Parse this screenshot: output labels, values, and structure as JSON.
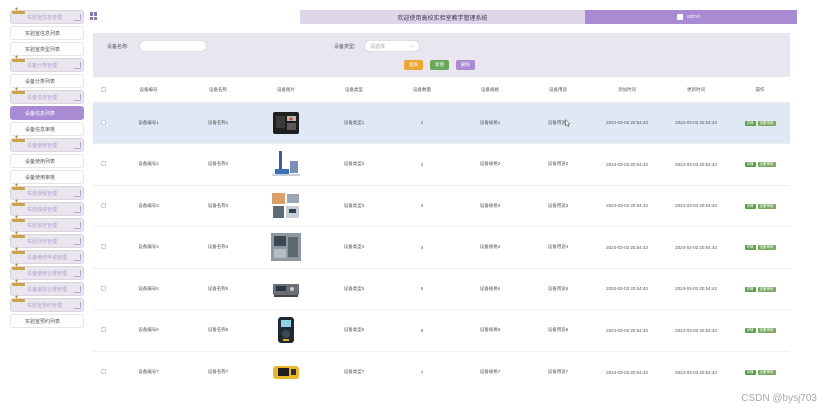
{
  "header": {
    "title": "欢迎使用高校实验室教学管理系统",
    "username": "admin"
  },
  "sidebar": {
    "items": [
      {
        "type": "group",
        "label": "实验室信息管理"
      },
      {
        "type": "sub",
        "label": "实验室信息列表"
      },
      {
        "type": "sub",
        "label": "实验室类型列表"
      },
      {
        "type": "group",
        "label": "设备分类管理"
      },
      {
        "type": "sub",
        "label": "设备分类列表"
      },
      {
        "type": "group",
        "label": "设备信息管理"
      },
      {
        "type": "sub",
        "label": "设备信息列表",
        "active": true
      },
      {
        "type": "sub",
        "label": "设备信息审核"
      },
      {
        "type": "group",
        "label": "设备使用管理"
      },
      {
        "type": "sub",
        "label": "设备使用列表"
      },
      {
        "type": "sub",
        "label": "设备使用审核"
      },
      {
        "type": "group",
        "label": "实验课程管理"
      },
      {
        "type": "group",
        "label": "实验成绩管理"
      },
      {
        "type": "group",
        "label": "实验报告管理"
      },
      {
        "type": "group",
        "label": "实验评价管理"
      },
      {
        "type": "group",
        "label": "设备维修申请管理"
      },
      {
        "type": "group",
        "label": "设备使用记录管理"
      },
      {
        "type": "group",
        "label": "设备报损记录管理"
      },
      {
        "type": "group",
        "label": "实验室预约管理"
      },
      {
        "type": "sub",
        "label": "实验室预约列表"
      }
    ]
  },
  "search": {
    "name_label": "设备名称:",
    "name_placeholder": "",
    "type_label": "设备类型:",
    "type_placeholder": "请选择",
    "query_btn": "查询",
    "add_btn": "新增",
    "delete_btn": "删除"
  },
  "colors": {
    "accent": "#a98bd4",
    "query_btn": "#f0a636",
    "add_btn": "#6aa65c",
    "delete_btn": "#a98bd4"
  },
  "table": {
    "columns": [
      "设备编号",
      "设备名称",
      "设备图片",
      "设备类型",
      "设备数量",
      "设备规格",
      "设备用途",
      "添加时间",
      "更新时间",
      "操作"
    ],
    "actions": {
      "detail": "详情",
      "audit": "设备审核"
    },
    "rows": [
      {
        "code": "设备编号1",
        "name": "设备名称1",
        "type": "设备类型1",
        "qty": "1",
        "spec": "设备规格1",
        "usage": "设备用途1",
        "created": "2024-03-03 20:54:43",
        "updated": "2024-03-03 20:54:43",
        "img": "toolcase"
      },
      {
        "code": "设备编号2",
        "name": "设备名称2",
        "type": "设备类型2",
        "qty": "2",
        "spec": "设备规格2",
        "usage": "设备用途2",
        "created": "2024-03-03 20:54:43",
        "updated": "2024-03-03 20:54:43",
        "img": "microscope"
      },
      {
        "code": "设备编号3",
        "name": "设备名称3",
        "type": "设备类型3",
        "qty": "3",
        "spec": "设备规格3",
        "usage": "设备用途3",
        "created": "2024-03-03 20:54:43",
        "updated": "2024-03-03 20:54:43",
        "img": "instruments"
      },
      {
        "code": "设备编号4",
        "name": "设备名称4",
        "type": "设备类型4",
        "qty": "4",
        "spec": "设备规格4",
        "usage": "设备用途4",
        "created": "2024-03-03 20:54:43",
        "updated": "2024-03-03 20:54:43",
        "img": "station"
      },
      {
        "code": "设备编号5",
        "name": "设备名称5",
        "type": "设备类型5",
        "qty": "5",
        "spec": "设备规格5",
        "usage": "设备用途5",
        "created": "2024-03-03 20:54:43",
        "updated": "2024-03-03 20:54:43",
        "img": "analyzer"
      },
      {
        "code": "设备编号6",
        "name": "设备名称6",
        "type": "设备类型6",
        "qty": "6",
        "spec": "设备规格6",
        "usage": "设备用途6",
        "created": "2024-03-03 20:54:43",
        "updated": "2024-03-03 20:54:43",
        "img": "meter"
      },
      {
        "code": "设备编号7",
        "name": "设备名称7",
        "type": "设备类型7",
        "qty": "7",
        "spec": "设备规格7",
        "usage": "设备用途7",
        "created": "2024-03-03 20:54:43",
        "updated": "2024-03-03 20:54:43",
        "img": "yellowdevice"
      }
    ]
  },
  "watermark": "CSDN @bysj703"
}
